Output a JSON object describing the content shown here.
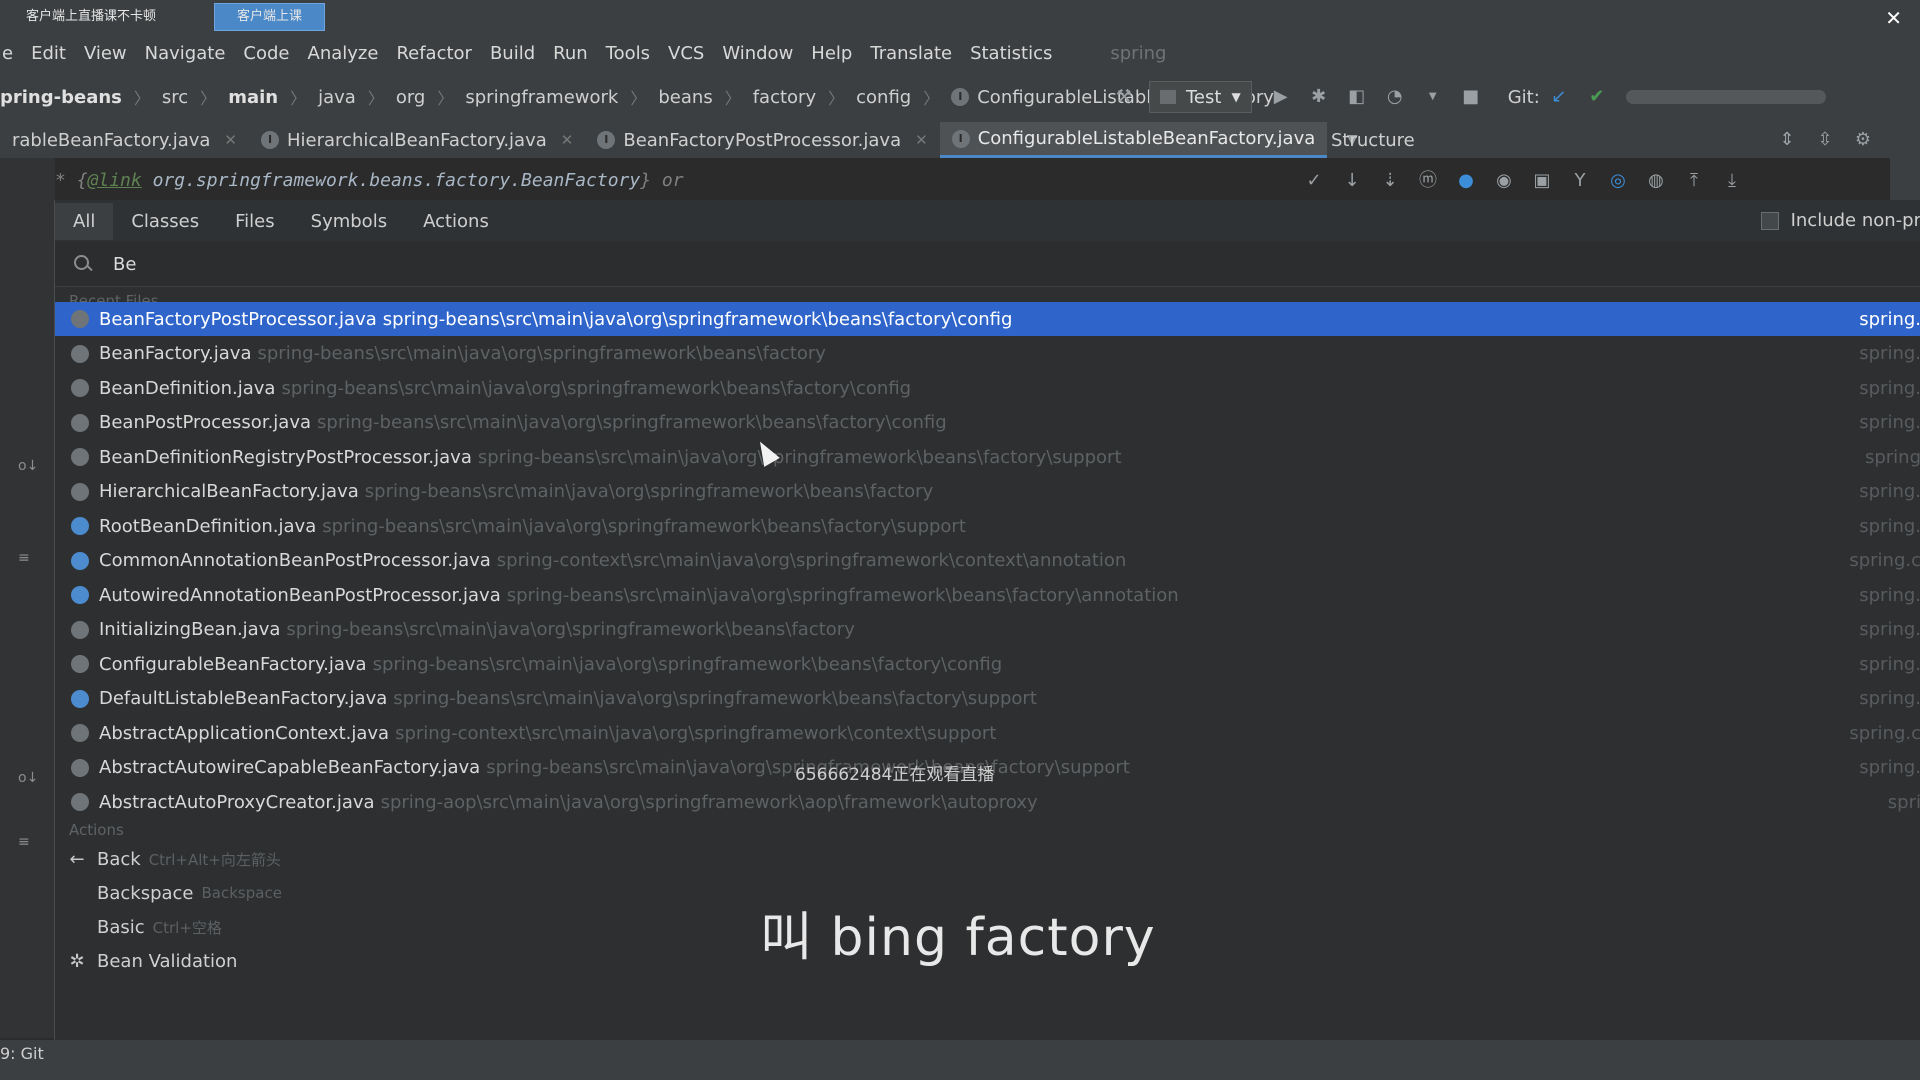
{
  "stream": {
    "tabs": [
      "客户端上直播课不卡顿",
      "客户端上课"
    ],
    "close": "✕"
  },
  "menu": [
    "e",
    "Edit",
    "View",
    "Navigate",
    "Code",
    "Analyze",
    "Refactor",
    "Build",
    "Run",
    "Tools",
    "VCS",
    "Window",
    "Help",
    "Translate",
    "Statistics"
  ],
  "menu_project": "spring",
  "breadcrumb": [
    "pring-beans",
    "src",
    "main",
    "java",
    "org",
    "springframework",
    "beans",
    "factory",
    "config",
    "ConfigurableListableBeanFactory"
  ],
  "run_config": "Test",
  "git_label": "Git:",
  "editor_tabs": [
    {
      "label": "rableBeanFactory.java",
      "close": "✕"
    },
    {
      "label": "HierarchicalBeanFactory.java",
      "close": "✕"
    },
    {
      "label": "BeanFactoryPostProcessor.java",
      "close": "✕"
    },
    {
      "label": "ConfigurableListableBeanFactory.java",
      "close": ""
    }
  ],
  "structure_title": "Structure",
  "editor_line": {
    "star": "*",
    "open": "{",
    "tag": "@link",
    "ref": "org.springframework.beans.factory.BeanFactory",
    "close": "}",
    "tail": "or"
  },
  "popup": {
    "tabs": [
      "All",
      "Classes",
      "Files",
      "Symbols",
      "Actions"
    ],
    "include_label": "Include non-pr",
    "query": "Be",
    "recent_section": "Recent Files",
    "files": [
      {
        "name": "BeanFactoryPostProcessor.java",
        "path": "spring-beans\\src\\main\\java\\org\\springframework\\beans\\factory\\config",
        "module": "spring.",
        "icon": "interface-icon"
      },
      {
        "name": "BeanFactory.java",
        "path": "spring-beans\\src\\main\\java\\org\\springframework\\beans\\factory",
        "module": "spring.",
        "icon": "interface-icon"
      },
      {
        "name": "BeanDefinition.java",
        "path": "spring-beans\\src\\main\\java\\org\\springframework\\beans\\factory\\config",
        "module": "spring.",
        "icon": "interface-icon"
      },
      {
        "name": "BeanPostProcessor.java",
        "path": "spring-beans\\src\\main\\java\\org\\springframework\\beans\\factory\\config",
        "module": "spring.",
        "icon": "interface-icon"
      },
      {
        "name": "BeanDefinitionRegistryPostProcessor.java",
        "path": "spring-beans\\src\\main\\java\\org\\springframework\\beans\\factory\\support",
        "module": "spring",
        "icon": "interface-icon"
      },
      {
        "name": "HierarchicalBeanFactory.java",
        "path": "spring-beans\\src\\main\\java\\org\\springframework\\beans\\factory",
        "module": "spring.",
        "icon": "interface-icon"
      },
      {
        "name": "RootBeanDefinition.java",
        "path": "spring-beans\\src\\main\\java\\org\\springframework\\beans\\factory\\support",
        "module": "spring.",
        "icon": "class-icon"
      },
      {
        "name": "CommonAnnotationBeanPostProcessor.java",
        "path": "spring-context\\src\\main\\java\\org\\springframework\\context\\annotation",
        "module": "spring.c",
        "icon": "class-icon"
      },
      {
        "name": "AutowiredAnnotationBeanPostProcessor.java",
        "path": "spring-beans\\src\\main\\java\\org\\springframework\\beans\\factory\\annotation",
        "module": "spring.",
        "icon": "class-icon"
      },
      {
        "name": "InitializingBean.java",
        "path": "spring-beans\\src\\main\\java\\org\\springframework\\beans\\factory",
        "module": "spring.",
        "icon": "interface-icon"
      },
      {
        "name": "ConfigurableBeanFactory.java",
        "path": "spring-beans\\src\\main\\java\\org\\springframework\\beans\\factory\\config",
        "module": "spring.",
        "icon": "interface-icon"
      },
      {
        "name": "DefaultListableBeanFactory.java",
        "path": "spring-beans\\src\\main\\java\\org\\springframework\\beans\\factory\\support",
        "module": "spring.",
        "icon": "class-icon"
      },
      {
        "name": "AbstractApplicationContext.java",
        "path": "spring-context\\src\\main\\java\\org\\springframework\\context\\support",
        "module": "spring.c",
        "icon": "abstract-class-icon"
      },
      {
        "name": "AbstractAutowireCapableBeanFactory.java",
        "path": "spring-beans\\src\\main\\java\\org\\springframework\\beans\\factory\\support",
        "module": "spring.",
        "icon": "abstract-class-icon"
      },
      {
        "name": "AbstractAutoProxyCreator.java",
        "path": "spring-aop\\src\\main\\java\\org\\springframework\\aop\\framework\\autoproxy",
        "module": "spri",
        "icon": "abstract-class-icon"
      }
    ],
    "actions_section": "Actions",
    "actions": [
      {
        "icon": "arrow-left-icon",
        "glyph": "←",
        "label": "Back",
        "shortcut": "Ctrl+Alt+向左箭头"
      },
      {
        "icon": "",
        "glyph": "",
        "label": "Backspace",
        "shortcut": "Backspace"
      },
      {
        "icon": "",
        "glyph": "",
        "label": "Basic",
        "shortcut": "Ctrl+空格"
      },
      {
        "icon": "bean-validation-icon",
        "glyph": "✲",
        "label": "Bean Validation",
        "shortcut": ""
      }
    ]
  },
  "overlay": {
    "viewers": "656662484正在观看直播",
    "subtitle": "叫 bing factory"
  },
  "bottom_bar": "9: Git",
  "colors": {
    "selection": "#2f65ca",
    "accent": "#4a88c7",
    "background": "#2b2b2b"
  }
}
